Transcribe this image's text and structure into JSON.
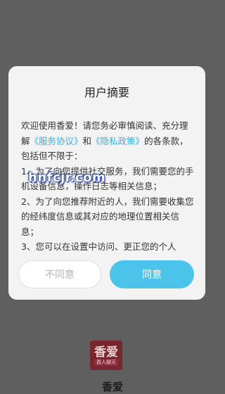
{
  "dialog": {
    "title": "用户摘要",
    "intro_1": "欢迎使用香爱！请您务必审慎阅读、充分理解",
    "link_service": "《服务协议》",
    "intro_and": "和",
    "link_privacy": "《隐私政策》",
    "intro_2": "的各条款，包括但不限于：",
    "item_1": "1、为了向您提供社交服务，我们需要您的手机设备信息，操作日志等相关信息；",
    "item_2": "2、为了向您推荐附近的人，我们需要收集您的经纬度信息或其对应的地理位置相关信息；",
    "item_3": "3、您可以在设置中访问、更正您的个人",
    "disagree_label": "不同意",
    "agree_label": "同意"
  },
  "watermark": "hnfcjr.com",
  "logo": {
    "main": "香爱",
    "sub": "真人聊天"
  },
  "app_name": "香爱",
  "colors": {
    "accent": "#4cc3ea",
    "link": "#3aaee0",
    "overlay": "#5f5f5f"
  }
}
